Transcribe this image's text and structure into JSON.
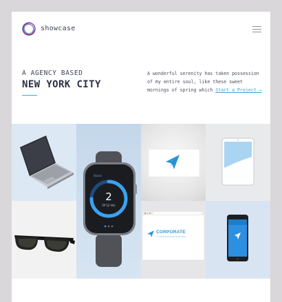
{
  "brand": {
    "name": "showcase",
    "logo_icon": "ring-logo-icon"
  },
  "header": {
    "menu_icon": "hamburger-menu-icon"
  },
  "hero": {
    "eyebrow": "A AGENCY BASED",
    "title": "NEW YORK CITY",
    "intro_text": "A wonderful serenity has taken possession of my entire soul, like these sweet mornings of spring which",
    "cta_label": "Start a Project →"
  },
  "portfolio": {
    "watch": {
      "app_label": "Stand",
      "number": "2",
      "subtext": "Of 12 Hrs"
    },
    "corporate": {
      "name": "CORPORATE",
      "tagline": "YOUR BUSINESS PARTNER"
    }
  },
  "colors": {
    "accent": "#45a6de",
    "text_dark": "#2d3142",
    "background": "#d9d7d9"
  }
}
